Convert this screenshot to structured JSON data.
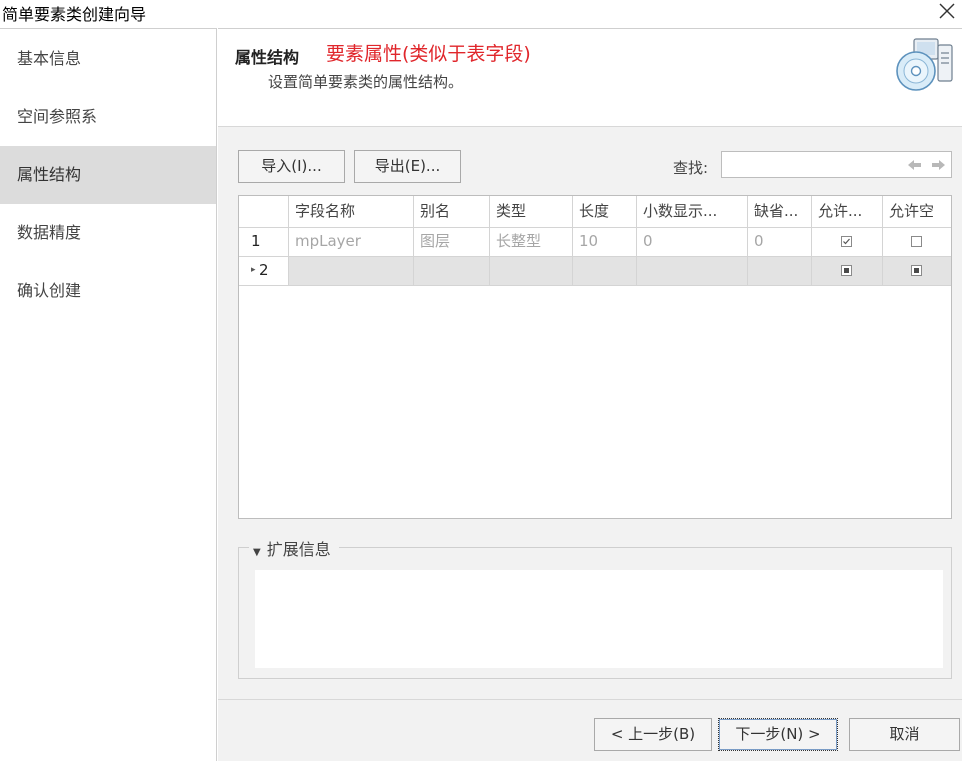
{
  "window": {
    "title": "简单要素类创建向导",
    "close_icon": "close-icon"
  },
  "sidebar": {
    "items": [
      {
        "label": "基本信息"
      },
      {
        "label": "空间参照系"
      },
      {
        "label": "属性结构",
        "active": true
      },
      {
        "label": "数据精度"
      },
      {
        "label": "确认创建"
      }
    ]
  },
  "header": {
    "title": "属性结构",
    "note": "要素属性(类似于表字段)",
    "subtitle": "设置简单要素类的属性结构。",
    "icon": "database-disk-icon"
  },
  "toolbar": {
    "import_label": "导入(I)...",
    "export_label": "导出(E)...",
    "find_label": "查找:",
    "find_value": "",
    "find_prev_icon": "arrow-left-icon",
    "find_next_icon": "arrow-right-icon"
  },
  "table": {
    "columns": [
      "字段名称",
      "别名",
      "类型",
      "长度",
      "小数显示...",
      "缺省...",
      "允许...",
      "允许空"
    ],
    "rows": [
      {
        "num": "1",
        "name": "mpLayer",
        "alias": "图层",
        "type": "长整型",
        "length": "10",
        "decimals": "0",
        "default": "0",
        "allow": "checked",
        "allow_null": "unchecked"
      },
      {
        "num": "2",
        "current": true,
        "name": "",
        "alias": "",
        "type": "",
        "length": "",
        "decimals": "",
        "default": "",
        "allow": "indeterminate",
        "allow_null": "indeterminate"
      }
    ]
  },
  "extension": {
    "label": "扩展信息",
    "expanded": false
  },
  "footer": {
    "prev_label": "< 上一步(B)",
    "next_label": "下一步(N) >",
    "cancel_label": "取消"
  },
  "colors": {
    "accent_red": "#e0262b",
    "selected_item_bg": "#dcdcdc",
    "panel_bg": "#f2f2f2"
  }
}
